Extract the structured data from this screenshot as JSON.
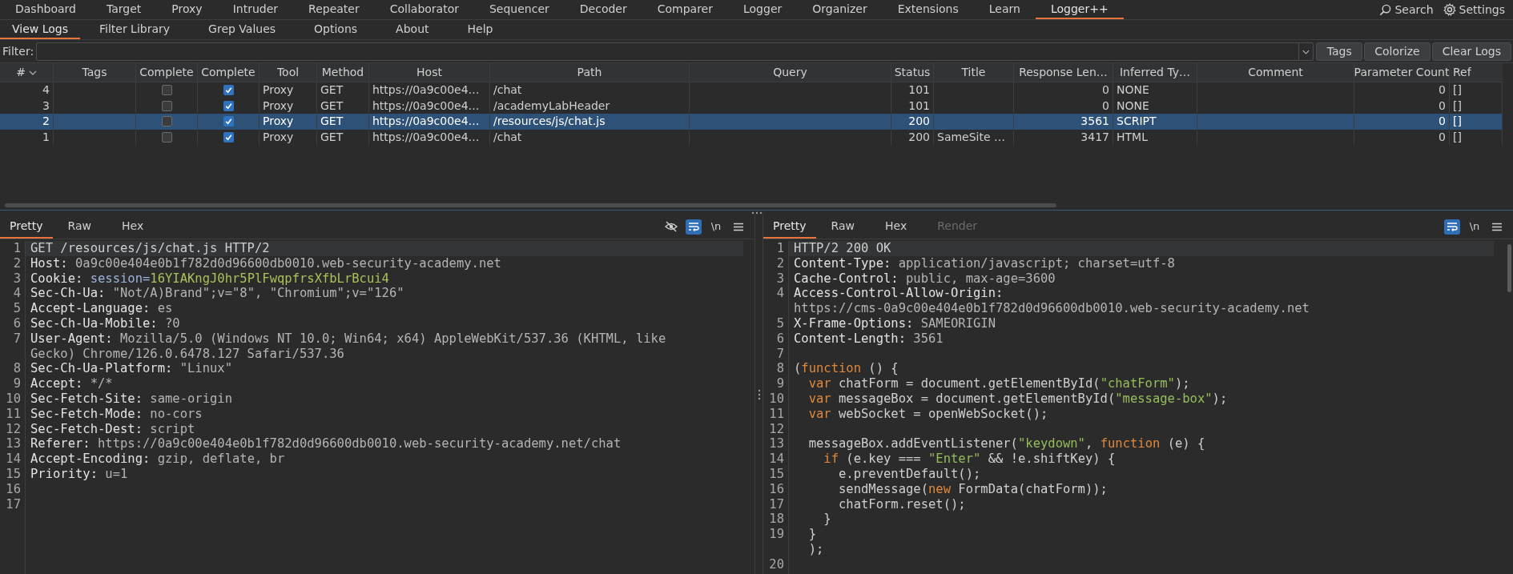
{
  "top_tabs": [
    {
      "label": "Dashboard",
      "selected": false
    },
    {
      "label": "Target",
      "selected": false
    },
    {
      "label": "Proxy",
      "selected": false
    },
    {
      "label": "Intruder",
      "selected": false
    },
    {
      "label": "Repeater",
      "selected": false
    },
    {
      "label": "Collaborator",
      "selected": false
    },
    {
      "label": "Sequencer",
      "selected": false
    },
    {
      "label": "Decoder",
      "selected": false
    },
    {
      "label": "Comparer",
      "selected": false
    },
    {
      "label": "Logger",
      "selected": false
    },
    {
      "label": "Organizer",
      "selected": false
    },
    {
      "label": "Extensions",
      "selected": false
    },
    {
      "label": "Learn",
      "selected": false
    },
    {
      "label": "Logger++",
      "selected": true
    }
  ],
  "top_actions": [
    {
      "kind": "search",
      "label": "Search"
    },
    {
      "kind": "settings",
      "label": "Settings"
    }
  ],
  "sub_tabs": [
    {
      "label": "View Logs",
      "selected": true
    },
    {
      "label": "Filter Library",
      "selected": false
    },
    {
      "label": "Grep Values",
      "selected": false
    },
    {
      "label": "Options",
      "selected": false
    },
    {
      "label": "About",
      "selected": false
    },
    {
      "label": "Help",
      "selected": false
    }
  ],
  "filter": {
    "label": "Filter:",
    "buttons": [
      "Tags",
      "Colorize",
      "Clear Logs"
    ]
  },
  "table": {
    "columns": [
      "#",
      "Tags",
      "Complete",
      "Complete",
      "Tool",
      "Method",
      "Host",
      "Path",
      "Query",
      "Status",
      "Title",
      "Response Len…",
      "Inferred Ty…",
      "Comment",
      "Parameter Count",
      "Ref"
    ],
    "rows": [
      {
        "number": "4",
        "complete_1": false,
        "complete_2": true,
        "tool": "Proxy",
        "method": "GET",
        "host": "https://0a9c00e4…",
        "path": "/chat",
        "status": "101",
        "response_length": "0",
        "inferred_type": "NONE",
        "parameter_count": "0",
        "column_16": "[]",
        "selected": false
      },
      {
        "number": "3",
        "complete_1": false,
        "complete_2": true,
        "tool": "Proxy",
        "method": "GET",
        "host": "https://0a9c00e4…",
        "path": "/academyLabHeader",
        "status": "101",
        "response_length": "0",
        "inferred_type": "NONE",
        "parameter_count": "0",
        "column_16": "[]",
        "selected": false
      },
      {
        "number": "2",
        "complete_1": false,
        "complete_2": true,
        "tool": "Proxy",
        "method": "GET",
        "host": "https://0a9c00e4…",
        "path": "/resources/js/chat.js",
        "status": "200",
        "response_length": "3561",
        "inferred_type": "SCRIPT",
        "parameter_count": "0",
        "column_16": "[]",
        "selected": true
      },
      {
        "number": "1",
        "complete_1": false,
        "complete_2": true,
        "tool": "Proxy",
        "method": "GET",
        "host": "https://0a9c00e4…",
        "path": "/chat",
        "status": "200",
        "title": "SameSite …",
        "response_length": "3417",
        "inferred_type": "HTML",
        "parameter_count": "0",
        "column_16": "[]",
        "selected": false
      }
    ]
  },
  "request": {
    "tabs": [
      {
        "label": "Pretty",
        "selected": true
      },
      {
        "label": "Raw",
        "selected": false
      },
      {
        "label": "Hex",
        "selected": false
      }
    ],
    "tools": [
      {
        "kind": "hide",
        "on": false
      },
      {
        "kind": "wrap",
        "on": true
      },
      {
        "kind": "newline",
        "label": "\\n",
        "on": false
      },
      {
        "kind": "menu",
        "on": false
      }
    ],
    "lines": [
      {
        "number": "1",
        "current": true,
        "rows": [
          [
            {
              "kind": "plain",
              "text": "GET /resources/js/chat.js HTTP/2"
            }
          ]
        ]
      },
      {
        "number": "2",
        "current": false,
        "rows": [
          [
            {
              "kind": "name",
              "text": "Host:"
            },
            {
              "kind": "value",
              "text": " 0a9c00e404e0b1f782d0d96600db0010.web-security-academy.net"
            }
          ]
        ]
      },
      {
        "number": "3",
        "current": false,
        "rows": [
          [
            {
              "kind": "name",
              "text": "Cookie:"
            },
            {
              "kind": "value",
              "text": " "
            },
            {
              "kind": "param",
              "text": "session="
            },
            {
              "kind": "cookie",
              "text": "16YIAKngJ0hr5PlFwqpfrsXfbLrBcui4"
            }
          ]
        ]
      },
      {
        "number": "4",
        "current": false,
        "rows": [
          [
            {
              "kind": "name",
              "text": "Sec-Ch-Ua:"
            },
            {
              "kind": "value",
              "text": " \"Not/A)Brand\";v=\"8\", \"Chromium\";v=\"126\""
            }
          ]
        ]
      },
      {
        "number": "5",
        "current": false,
        "rows": [
          [
            {
              "kind": "name",
              "text": "Accept-Language:"
            },
            {
              "kind": "value",
              "text": " es"
            }
          ]
        ]
      },
      {
        "number": "6",
        "current": false,
        "rows": [
          [
            {
              "kind": "name",
              "text": "Sec-Ch-Ua-Mobile:"
            },
            {
              "kind": "value",
              "text": " ?0"
            }
          ]
        ]
      },
      {
        "number": "7",
        "current": false,
        "rows": [
          [
            {
              "kind": "name",
              "text": "User-Agent:"
            },
            {
              "kind": "value",
              "text": " Mozilla/5.0 (Windows NT 10.0; Win64; x64) AppleWebKit/537.36 (KHTML, like"
            }
          ],
          [
            {
              "kind": "value",
              "text": "Gecko) Chrome/126.0.6478.127 Safari/537.36"
            }
          ]
        ]
      },
      {
        "number": "8",
        "current": false,
        "rows": [
          [
            {
              "kind": "name",
              "text": "Sec-Ch-Ua-Platform:"
            },
            {
              "kind": "value",
              "text": " \"Linux\""
            }
          ]
        ]
      },
      {
        "number": "9",
        "current": false,
        "rows": [
          [
            {
              "kind": "name",
              "text": "Accept:"
            },
            {
              "kind": "value",
              "text": " */*"
            }
          ]
        ]
      },
      {
        "number": "10",
        "current": false,
        "rows": [
          [
            {
              "kind": "name",
              "text": "Sec-Fetch-Site:"
            },
            {
              "kind": "value",
              "text": " same-origin"
            }
          ]
        ]
      },
      {
        "number": "11",
        "current": false,
        "rows": [
          [
            {
              "kind": "name",
              "text": "Sec-Fetch-Mode:"
            },
            {
              "kind": "value",
              "text": " no-cors"
            }
          ]
        ]
      },
      {
        "number": "12",
        "current": false,
        "rows": [
          [
            {
              "kind": "name",
              "text": "Sec-Fetch-Dest:"
            },
            {
              "kind": "value",
              "text": " script"
            }
          ]
        ]
      },
      {
        "number": "13",
        "current": false,
        "rows": [
          [
            {
              "kind": "name",
              "text": "Referer:"
            },
            {
              "kind": "value",
              "text": " https://0a9c00e404e0b1f782d0d96600db0010.web-security-academy.net/chat"
            }
          ]
        ]
      },
      {
        "number": "14",
        "current": false,
        "rows": [
          [
            {
              "kind": "name",
              "text": "Accept-Encoding:"
            },
            {
              "kind": "value",
              "text": " gzip, deflate, br"
            }
          ]
        ]
      },
      {
        "number": "15",
        "current": false,
        "rows": [
          [
            {
              "kind": "name",
              "text": "Priority:"
            },
            {
              "kind": "value",
              "text": " u=1"
            }
          ]
        ]
      },
      {
        "number": "16",
        "current": false,
        "rows": [
          []
        ]
      },
      {
        "number": "17",
        "current": false,
        "rows": [
          []
        ]
      }
    ]
  },
  "response": {
    "tabs": [
      {
        "label": "Pretty",
        "selected": true,
        "disabled": false
      },
      {
        "label": "Raw",
        "selected": false,
        "disabled": false
      },
      {
        "label": "Hex",
        "selected": false,
        "disabled": false
      },
      {
        "label": "Render",
        "selected": false,
        "disabled": true
      }
    ],
    "tools": [
      {
        "kind": "wrap",
        "on": true
      },
      {
        "kind": "newline",
        "label": "\\n",
        "on": false
      },
      {
        "kind": "menu",
        "on": false
      }
    ],
    "lines": [
      {
        "number": "1",
        "current": true,
        "rows": [
          [
            {
              "kind": "plain",
              "text": "HTTP/2 200 OK"
            }
          ]
        ]
      },
      {
        "number": "2",
        "current": false,
        "rows": [
          [
            {
              "kind": "name",
              "text": "Content-Type:"
            },
            {
              "kind": "value",
              "text": " application/javascript; charset=utf-8"
            }
          ]
        ]
      },
      {
        "number": "3",
        "current": false,
        "rows": [
          [
            {
              "kind": "name",
              "text": "Cache-Control:"
            },
            {
              "kind": "value",
              "text": " public, max-age=3600"
            }
          ]
        ]
      },
      {
        "number": "4",
        "current": false,
        "rows": [
          [
            {
              "kind": "name",
              "text": "Access-Control-Allow-Origin:"
            }
          ],
          [
            {
              "kind": "value",
              "text": "https://cms-0a9c00e404e0b1f782d0d96600db0010.web-security-academy.net"
            }
          ]
        ]
      },
      {
        "number": "5",
        "current": false,
        "rows": [
          [
            {
              "kind": "name",
              "text": "X-Frame-Options:"
            },
            {
              "kind": "value",
              "text": " SAMEORIGIN"
            }
          ]
        ]
      },
      {
        "number": "6",
        "current": false,
        "rows": [
          [
            {
              "kind": "name",
              "text": "Content-Length:"
            },
            {
              "kind": "value",
              "text": " 3561"
            }
          ]
        ]
      },
      {
        "number": "7",
        "current": false,
        "rows": [
          []
        ]
      },
      {
        "number": "8",
        "current": false,
        "rows": [
          [
            {
              "kind": "plain",
              "text": "("
            },
            {
              "kind": "keyword",
              "text": "function"
            },
            {
              "kind": "plain",
              "text": " () {"
            }
          ]
        ]
      },
      {
        "number": "9",
        "current": false,
        "rows": [
          [
            {
              "kind": "plain",
              "text": "  "
            },
            {
              "kind": "keyword",
              "text": "var"
            },
            {
              "kind": "plain",
              "text": " chatForm = document.getElementById("
            },
            {
              "kind": "string",
              "text": "\"chatForm\""
            },
            {
              "kind": "plain",
              "text": ");"
            }
          ]
        ]
      },
      {
        "number": "10",
        "current": false,
        "rows": [
          [
            {
              "kind": "plain",
              "text": "  "
            },
            {
              "kind": "keyword",
              "text": "var"
            },
            {
              "kind": "plain",
              "text": " messageBox = document.getElementById("
            },
            {
              "kind": "string",
              "text": "\"message-box\""
            },
            {
              "kind": "plain",
              "text": ");"
            }
          ]
        ]
      },
      {
        "number": "11",
        "current": false,
        "rows": [
          [
            {
              "kind": "plain",
              "text": "  "
            },
            {
              "kind": "keyword",
              "text": "var"
            },
            {
              "kind": "plain",
              "text": " webSocket = openWebSocket();"
            }
          ]
        ]
      },
      {
        "number": "12",
        "current": false,
        "rows": [
          []
        ]
      },
      {
        "number": "13",
        "current": false,
        "rows": [
          [
            {
              "kind": "plain",
              "text": "  messageBox.addEventListener("
            },
            {
              "kind": "string",
              "text": "\"keydown\""
            },
            {
              "kind": "plain",
              "text": ", "
            },
            {
              "kind": "keyword",
              "text": "function"
            },
            {
              "kind": "plain",
              "text": " (e) {"
            }
          ]
        ]
      },
      {
        "number": "14",
        "current": false,
        "rows": [
          [
            {
              "kind": "plain",
              "text": "    "
            },
            {
              "kind": "keyword",
              "text": "if"
            },
            {
              "kind": "plain",
              "text": " (e.key === "
            },
            {
              "kind": "string",
              "text": "\"Enter\""
            },
            {
              "kind": "plain",
              "text": " && !e.shiftKey) {"
            }
          ]
        ]
      },
      {
        "number": "15",
        "current": false,
        "rows": [
          [
            {
              "kind": "plain",
              "text": "      e.preventDefault();"
            }
          ]
        ]
      },
      {
        "number": "16",
        "current": false,
        "rows": [
          [
            {
              "kind": "plain",
              "text": "      sendMessage("
            },
            {
              "kind": "keyword",
              "text": "new"
            },
            {
              "kind": "plain",
              "text": " FormData(chatForm));"
            }
          ]
        ]
      },
      {
        "number": "17",
        "current": false,
        "rows": [
          [
            {
              "kind": "plain",
              "text": "      chatForm.reset();"
            }
          ]
        ]
      },
      {
        "number": "18",
        "current": false,
        "rows": [
          [
            {
              "kind": "plain",
              "text": "    }"
            }
          ]
        ]
      },
      {
        "number": "19",
        "current": false,
        "rows": [
          [
            {
              "kind": "plain",
              "text": "  }"
            }
          ],
          [
            {
              "kind": "plain",
              "text": "  );"
            }
          ]
        ]
      },
      {
        "number": "20",
        "current": false,
        "rows": [
          []
        ]
      }
    ]
  }
}
